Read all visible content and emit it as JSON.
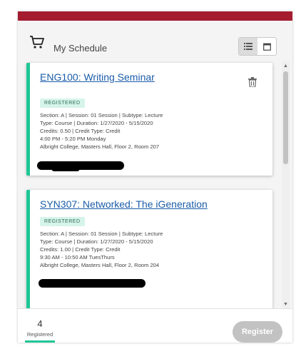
{
  "colors": {
    "brand": "#a51c30",
    "accent": "#1ec796",
    "link": "#1a5ca8",
    "badge_bg": "#d6f4ea",
    "button_disabled": "#c2c2c2"
  },
  "header": {
    "icon": "cart-icon",
    "title": "My Schedule",
    "view_toggle": [
      {
        "icon": "list-view-icon",
        "active": true
      },
      {
        "icon": "calendar-view-icon",
        "active": false
      }
    ]
  },
  "courses": [
    {
      "title": "ENG100: Writing Seminar",
      "status": "REGISTERED",
      "details": [
        "Section: A | Session: 01 Session | Subtype: Lecture",
        "Type: Course | Duration: 1/27/2020 - 5/15/2020",
        "Credits: 0.50 | Credit Type: Credit",
        "4:00 PM - 5:20 PM Monday",
        "Albright College, Masters Hall, Floor 2, Room 207"
      ],
      "action_icon": "trash-icon"
    },
    {
      "title": "SYN307: Networked: The iGeneration",
      "status": "REGISTERED",
      "details": [
        "Section: A | Session: 01 Session | Subtype: Lecture",
        "Type: Course | Duration: 1/27/2020 - 5/15/2020",
        "Credits: 1.00 | Credit Type: Credit",
        "9:30 AM - 10:50 AM TuesThurs",
        "Albright College, Masters Hall, Floor 2, Room 204"
      ]
    }
  ],
  "footer": {
    "registered_count": "4",
    "registered_label": "Registered",
    "register_button": "Register"
  }
}
